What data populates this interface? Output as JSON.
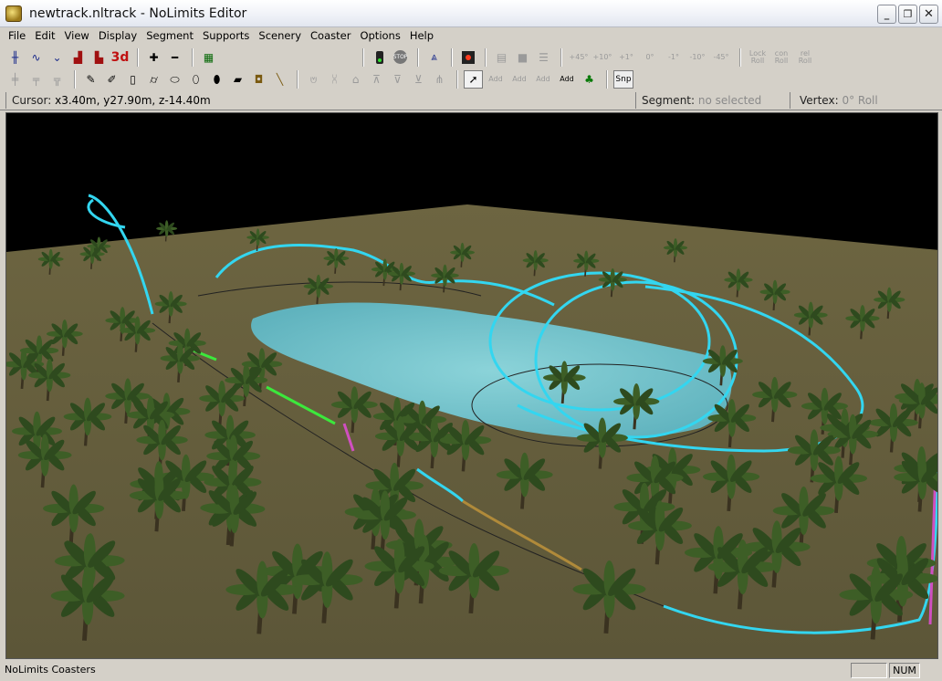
{
  "window": {
    "title": "newtrack.nltrack - NoLimits Editor",
    "minimize": "_",
    "restore": "❐",
    "close": "✕"
  },
  "menu": [
    "File",
    "Edit",
    "View",
    "Display",
    "Segment",
    "Supports",
    "Scenery",
    "Coaster",
    "Options",
    "Help"
  ],
  "toolbar_top": {
    "threed_label": "3d",
    "stop_label": "STOP",
    "roll_buttons": [
      "+45°",
      "+10°",
      "+1°",
      "0°",
      "-1°",
      "-10°",
      "-45°"
    ],
    "lock_roll": "Lock\nRoll",
    "con_roll": "con\nRoll",
    "rel_roll": "rel\nRoll"
  },
  "toolbar_bottom": {
    "add_labels": [
      "Add",
      "Add",
      "Add",
      "Add"
    ],
    "snap_label": "Snp"
  },
  "info": {
    "cursor_label": "Cursor:",
    "cursor_value": "x3.40m, y27.90m, z-14.40m",
    "segment_label": "Segment:",
    "segment_value": "no selected",
    "vertex_label": "Vertex:",
    "vertex_value": "0° Roll"
  },
  "statusbar": {
    "text": "NoLimits Coasters",
    "num": "NUM"
  },
  "colors": {
    "track": "#33d6f0",
    "water": "#7fd3e0",
    "ground": "#6b6442",
    "sky": "#000000",
    "palm": "#2e4a1e",
    "pink_track": "#d04fc0",
    "green_track": "#3ce83c"
  }
}
